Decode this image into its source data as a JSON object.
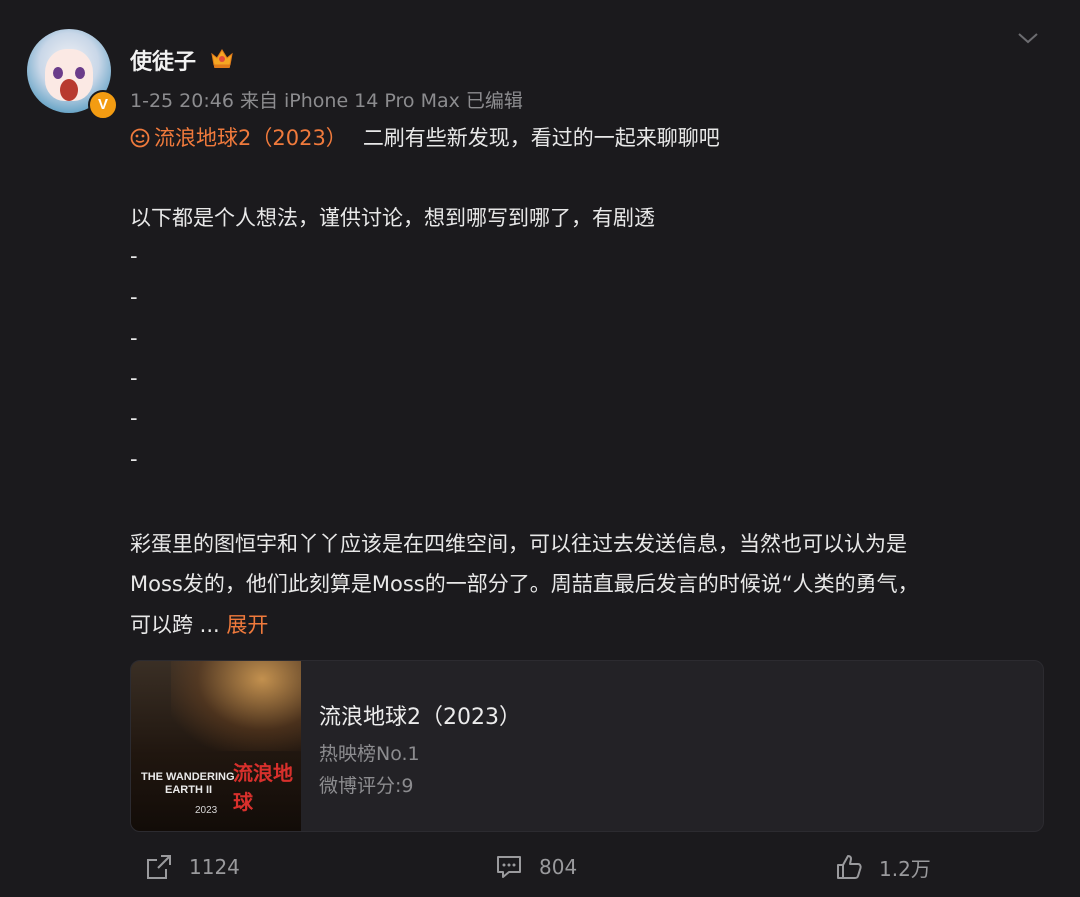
{
  "post": {
    "username": "使徒子",
    "meta": "1-25 20:46 来自 iPhone 14 Pro Max 已编辑",
    "verified_badge": "V",
    "topic": "流浪地球2（2023）",
    "topic_text": "二刷有些新发现，看过的一起来聊聊吧",
    "body_line1": "以下都是个人想法，谨供讨论，想到哪写到哪了，有剧透",
    "dashes": [
      "-",
      "-",
      "-",
      "-",
      "-",
      "-"
    ],
    "para_line1": "彩蛋里的图恒宇和丫丫应该是在四维空间，可以往过去发送信息，当然也可以认为是",
    "para_line2": "Moss发的，他们此刻算是Moss的一部分了。周喆直最后发言的时候说“人类的勇气，",
    "para_line3": "可以跨 ...",
    "expand_label": "展开"
  },
  "card": {
    "title": "流浪地球2（2023）",
    "subtitle1": "热映榜No.1",
    "subtitle2": "微博评分:9",
    "poster_text": {
      "line1": "THE WANDERING",
      "line2": "EARTH II",
      "line3": "2023",
      "cn": "流浪地球"
    }
  },
  "actions": {
    "repost_count": "1124",
    "comment_count": "804",
    "like_count": "1.2万"
  },
  "colors": {
    "background": "#1b1a1d",
    "accent": "#f07a3c",
    "muted": "#8c8c8f"
  }
}
